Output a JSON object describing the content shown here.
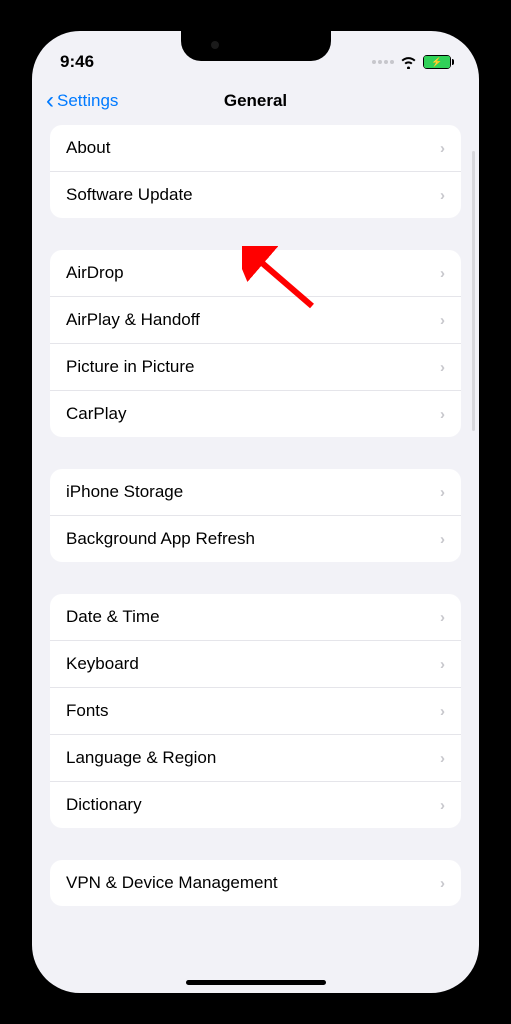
{
  "status": {
    "time": "9:46"
  },
  "nav": {
    "back": "Settings",
    "title": "General"
  },
  "groups": [
    {
      "items": [
        {
          "label": "About"
        },
        {
          "label": "Software Update"
        }
      ]
    },
    {
      "items": [
        {
          "label": "AirDrop"
        },
        {
          "label": "AirPlay & Handoff"
        },
        {
          "label": "Picture in Picture"
        },
        {
          "label": "CarPlay"
        }
      ]
    },
    {
      "items": [
        {
          "label": "iPhone Storage"
        },
        {
          "label": "Background App Refresh"
        }
      ]
    },
    {
      "items": [
        {
          "label": "Date & Time"
        },
        {
          "label": "Keyboard"
        },
        {
          "label": "Fonts"
        },
        {
          "label": "Language & Region"
        },
        {
          "label": "Dictionary"
        }
      ]
    },
    {
      "items": [
        {
          "label": "VPN & Device Management"
        }
      ]
    }
  ]
}
